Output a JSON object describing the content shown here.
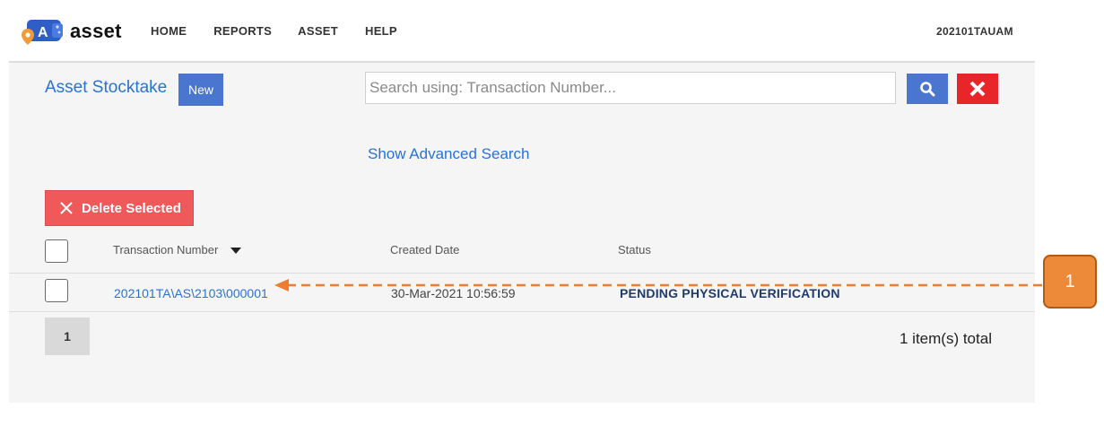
{
  "app": {
    "logo_letter": "A",
    "logo_text": "asset",
    "nav": [
      "HOME",
      "REPORTS",
      "ASSET",
      "HELP"
    ],
    "user": "202101TAUAM"
  },
  "page": {
    "title": "Asset Stocktake",
    "new_label": "New",
    "search_placeholder": "Search using: Transaction Number...",
    "search_value": "",
    "advanced_search_label": "Show Advanced Search",
    "delete_selected_label": "Delete Selected"
  },
  "table": {
    "headers": {
      "transaction_number": "Transaction Number",
      "created_date": "Created Date",
      "status": "Status"
    },
    "rows": [
      {
        "transaction_number": "202101TA\\AS\\2103\\000001",
        "created_date": "30-Mar-2021 10:56:59",
        "status": "PENDING PHYSICAL VERIFICATION",
        "selected": false
      }
    ]
  },
  "pagination": {
    "current_page": "1",
    "total_text": "1 item(s) total"
  },
  "callout": {
    "label": "1"
  },
  "colors": {
    "accent_blue": "#4a76d0",
    "link_blue": "#2a72d4",
    "danger_red": "#e8262a",
    "delete_red": "#f0595a",
    "callout_orange": "#ed8a3a",
    "status_navy": "#1f3b6b"
  },
  "icons": {
    "search_button": "search-icon",
    "clear_button": "close-icon",
    "delete_button": "close-icon",
    "sort": "caret-down-icon",
    "logo": "location-pin-icon"
  }
}
